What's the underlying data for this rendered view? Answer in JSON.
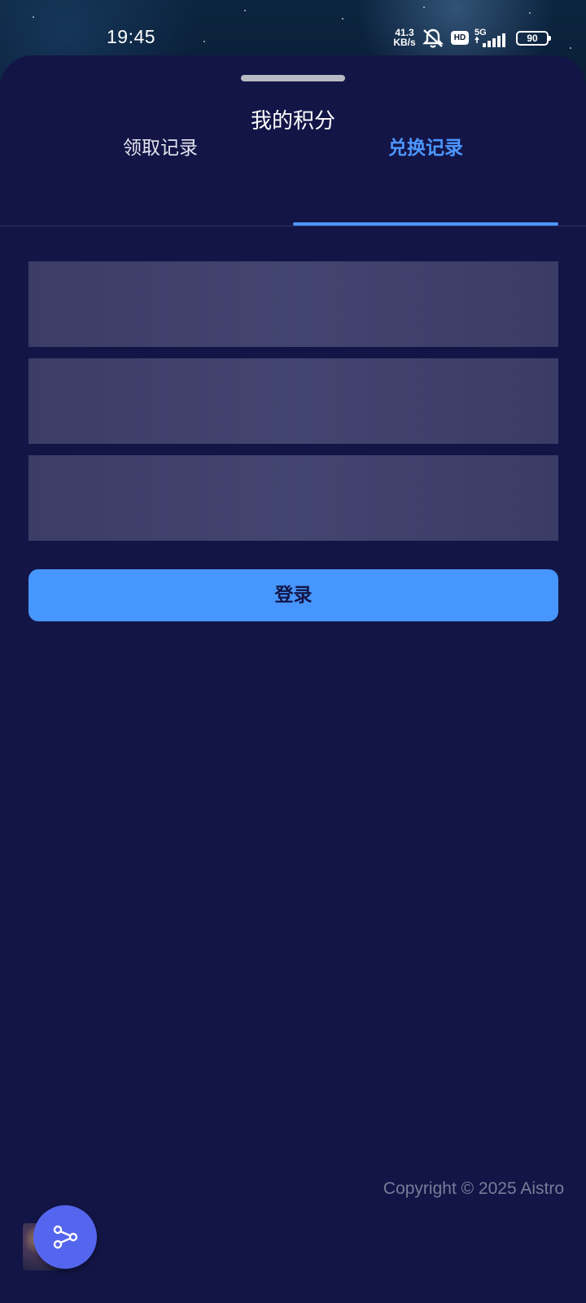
{
  "status_bar": {
    "time": "19:45",
    "net_speed_value": "41.3",
    "net_speed_unit": "KB/s",
    "hd_label": "HD",
    "network_type": "5G",
    "battery_level": "90",
    "icons": [
      "mute-icon",
      "signal-icon",
      "battery-icon"
    ]
  },
  "sheet": {
    "title": "我的积分",
    "tabs": [
      {
        "label": "领取记录",
        "active": false
      },
      {
        "label": "兑换记录",
        "active": true
      }
    ],
    "login_label": "登录",
    "copyright": "Copyright © 2025 Aistro"
  },
  "colors": {
    "accent": "#4c97ff",
    "button": "#4696fd",
    "sheet_bg": "#131547",
    "fab": "#5566ee"
  },
  "fab": {
    "icon": "share-icon"
  }
}
